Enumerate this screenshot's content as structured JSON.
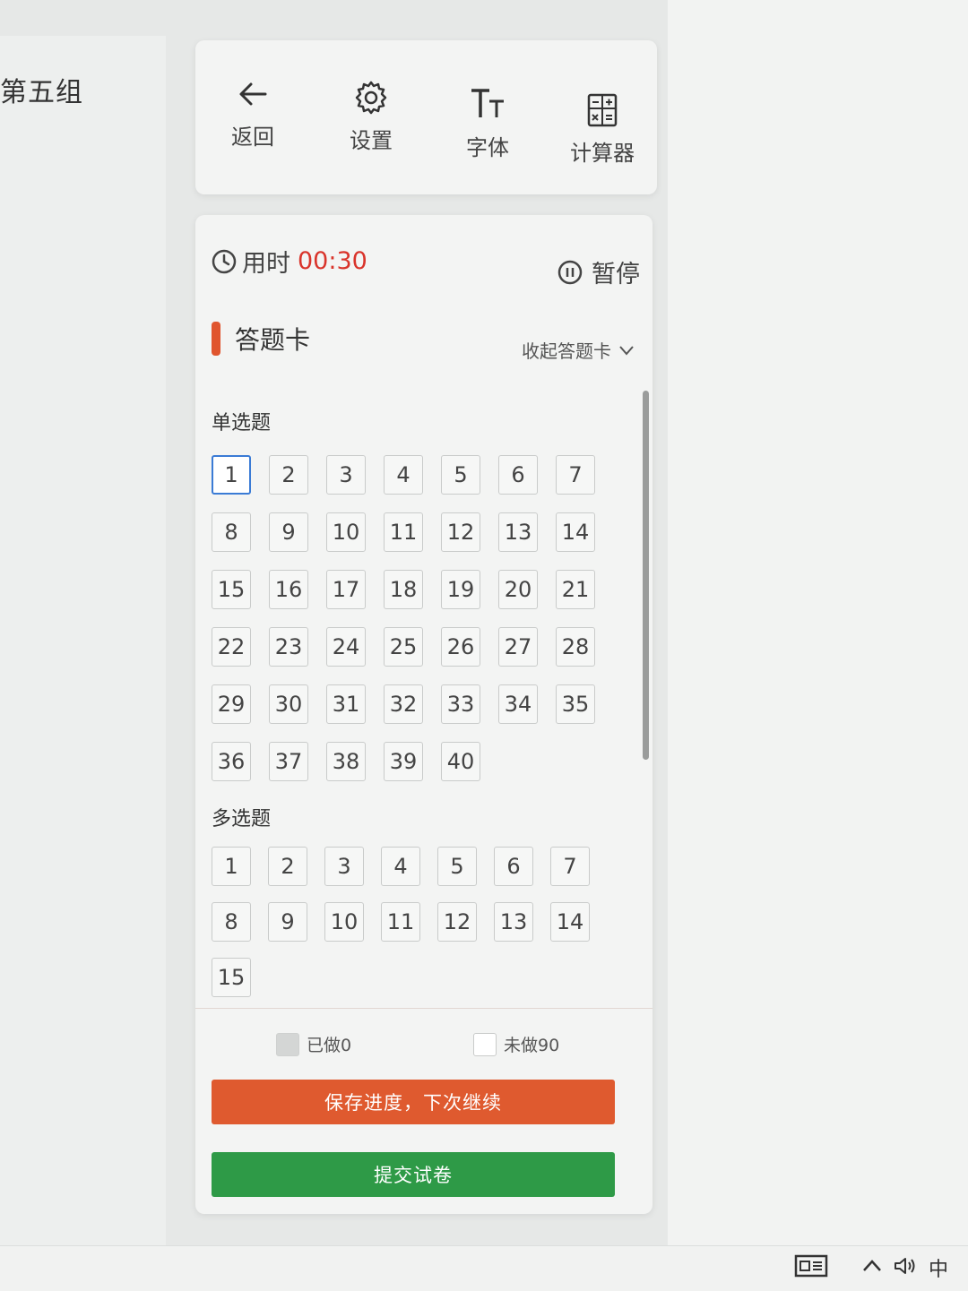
{
  "background": {
    "group_title": "第五组"
  },
  "toolbar": {
    "items": [
      {
        "label": "返回",
        "icon": "arrow-left-icon"
      },
      {
        "label": "设置",
        "icon": "gear-icon"
      },
      {
        "label": "字体",
        "icon": "font-size-icon"
      },
      {
        "label": "计算器",
        "icon": "calculator-icon"
      }
    ]
  },
  "timer": {
    "label": "用时",
    "value": "00:30",
    "pause_label": "暂停"
  },
  "answer_sheet": {
    "title": "答题卡",
    "collapse_label": "收起答题卡",
    "single": {
      "label": "单选题",
      "numbers": [
        "1",
        "2",
        "3",
        "4",
        "5",
        "6",
        "7",
        "8",
        "9",
        "10",
        "11",
        "12",
        "13",
        "14",
        "15",
        "16",
        "17",
        "18",
        "19",
        "20",
        "21",
        "22",
        "23",
        "24",
        "25",
        "26",
        "27",
        "28",
        "29",
        "30",
        "31",
        "32",
        "33",
        "34",
        "35",
        "36",
        "37",
        "38",
        "39",
        "40"
      ],
      "active": "1"
    },
    "multi": {
      "label": "多选题",
      "numbers": [
        "1",
        "2",
        "3",
        "4",
        "5",
        "6",
        "7",
        "8",
        "9",
        "10",
        "11",
        "12",
        "13",
        "14",
        "15"
      ]
    },
    "legend": {
      "done": "已做0",
      "todo": "未做90"
    }
  },
  "actions": {
    "save_label": "保存进度，下次继续",
    "submit_label": "提交试卷"
  },
  "taskbar": {
    "ime": "中"
  },
  "colors": {
    "accent_red": "#d9342b",
    "save_orange": "#df5a2f",
    "submit_green": "#2e9a47",
    "active_blue": "#3a7bd5"
  }
}
